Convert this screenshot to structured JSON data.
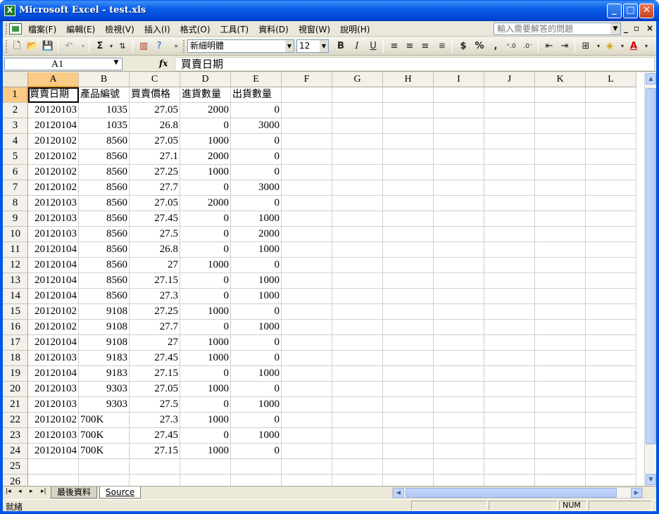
{
  "window": {
    "title": "Microsoft Excel - test.xls",
    "app_icon": "X"
  },
  "menu": {
    "items": [
      "檔案(F)",
      "編輯(E)",
      "檢視(V)",
      "插入(I)",
      "格式(O)",
      "工具(T)",
      "資料(D)",
      "視窗(W)",
      "說明(H)"
    ],
    "help_placeholder": "輸入需要解答的問題"
  },
  "toolbar": {
    "font_name": "新細明體",
    "font_size": "12",
    "bold": "B",
    "italic": "I",
    "underline": "U",
    "sum": "Σ",
    "currency": "$",
    "percent": "%",
    "comma": ","
  },
  "formula_bar": {
    "name_box": "A1",
    "fx": "fx",
    "content": "買賣日期"
  },
  "grid": {
    "columns": [
      "A",
      "B",
      "C",
      "D",
      "E",
      "F",
      "G",
      "H",
      "I",
      "J",
      "K",
      "L"
    ],
    "rows": [
      [
        "買賣日期",
        "產品編號",
        "買賣價格",
        "進貨數量",
        "出貨數量"
      ],
      [
        "20120103",
        "1035",
        "27.05",
        "2000",
        "0"
      ],
      [
        "20120104",
        "1035",
        "26.8",
        "0",
        "3000"
      ],
      [
        "20120102",
        "8560",
        "27.05",
        "1000",
        "0"
      ],
      [
        "20120102",
        "8560",
        "27.1",
        "2000",
        "0"
      ],
      [
        "20120102",
        "8560",
        "27.25",
        "1000",
        "0"
      ],
      [
        "20120102",
        "8560",
        "27.7",
        "0",
        "3000"
      ],
      [
        "20120103",
        "8560",
        "27.05",
        "2000",
        "0"
      ],
      [
        "20120103",
        "8560",
        "27.45",
        "0",
        "1000"
      ],
      [
        "20120103",
        "8560",
        "27.5",
        "0",
        "2000"
      ],
      [
        "20120104",
        "8560",
        "26.8",
        "0",
        "1000"
      ],
      [
        "20120104",
        "8560",
        "27",
        "1000",
        "0"
      ],
      [
        "20120104",
        "8560",
        "27.15",
        "0",
        "1000"
      ],
      [
        "20120104",
        "8560",
        "27.3",
        "0",
        "1000"
      ],
      [
        "20120102",
        "9108",
        "27.25",
        "1000",
        "0"
      ],
      [
        "20120102",
        "9108",
        "27.7",
        "0",
        "1000"
      ],
      [
        "20120104",
        "9108",
        "27",
        "1000",
        "0"
      ],
      [
        "20120103",
        "9183",
        "27.45",
        "1000",
        "0"
      ],
      [
        "20120104",
        "9183",
        "27.15",
        "0",
        "1000"
      ],
      [
        "20120103",
        "9303",
        "27.05",
        "1000",
        "0"
      ],
      [
        "20120103",
        "9303",
        "27.5",
        "0",
        "1000"
      ],
      [
        "20120102",
        "700K",
        "27.3",
        "1000",
        "0"
      ],
      [
        "20120103",
        "700K",
        "27.45",
        "0",
        "1000"
      ],
      [
        "20120104",
        "700K",
        "27.15",
        "1000",
        "0"
      ],
      [
        "",
        "",
        "",
        "",
        ""
      ],
      [
        "",
        "",
        "",
        "",
        ""
      ]
    ],
    "row_numbers": [
      "1",
      "2",
      "3",
      "4",
      "5",
      "6",
      "7",
      "8",
      "9",
      "10",
      "11",
      "12",
      "13",
      "14",
      "15",
      "16",
      "17",
      "18",
      "19",
      "20",
      "21",
      "22",
      "23",
      "24",
      "25",
      "26"
    ],
    "active_cell": "A1"
  },
  "sheets": {
    "tabs": [
      "最後資料",
      "Source"
    ],
    "active": "Source"
  },
  "status": {
    "text": "就緒",
    "num": "NUM"
  }
}
